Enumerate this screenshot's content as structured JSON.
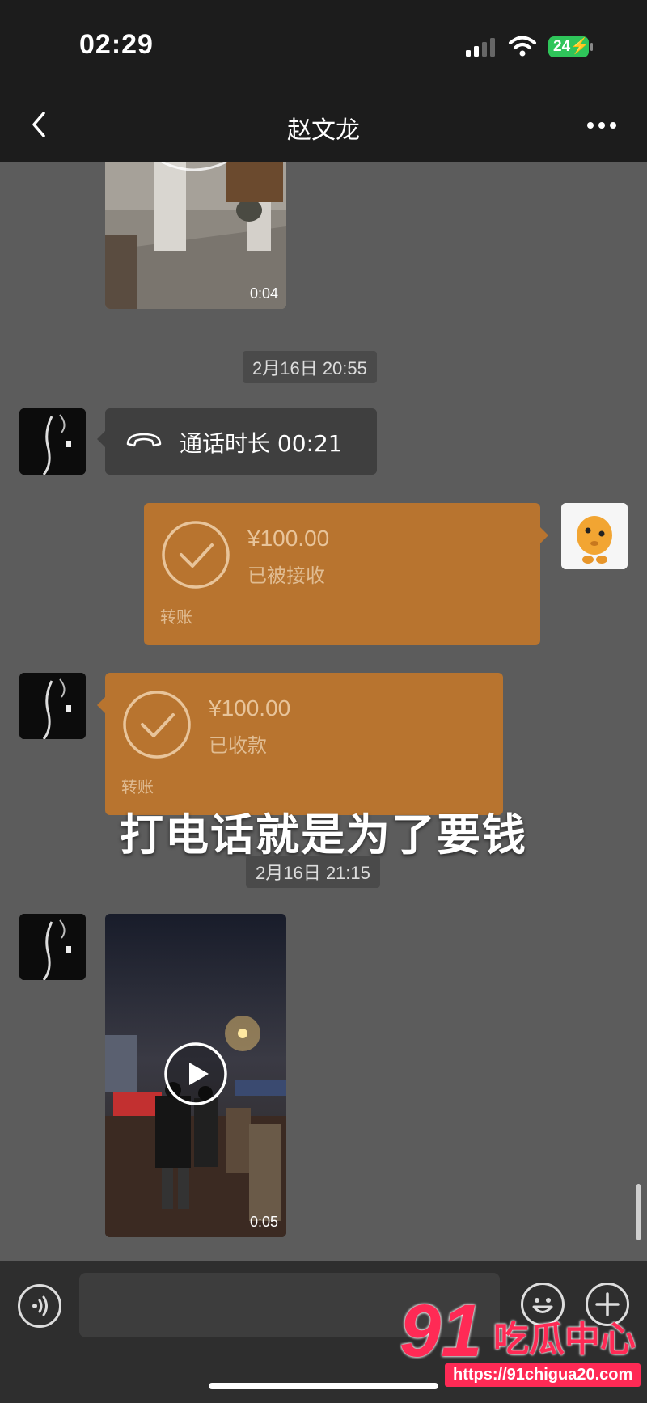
{
  "status_bar": {
    "time": "02:29",
    "battery": "24"
  },
  "header": {
    "title": "赵文龙"
  },
  "messages": {
    "video1": {
      "duration": "0:04"
    },
    "time1": "2月16日 20:55",
    "call": {
      "text": "通话时长 00:21"
    },
    "transfer_sent": {
      "amount": "¥100.00",
      "status": "已被接收",
      "type": "转账"
    },
    "transfer_received": {
      "amount": "¥100.00",
      "status": "已收款",
      "type": "转账"
    },
    "time2": "2月16日 21:15",
    "video2": {
      "duration": "0:05"
    }
  },
  "caption": "打电话就是为了要钱",
  "watermark": {
    "number": "91",
    "name": "吃瓜中心",
    "url": "https://91chigua20.com"
  },
  "colors": {
    "transfer": "#b8742f",
    "chat_bg": "#5c5c5c",
    "bar_bg": "#1c1c1c"
  }
}
